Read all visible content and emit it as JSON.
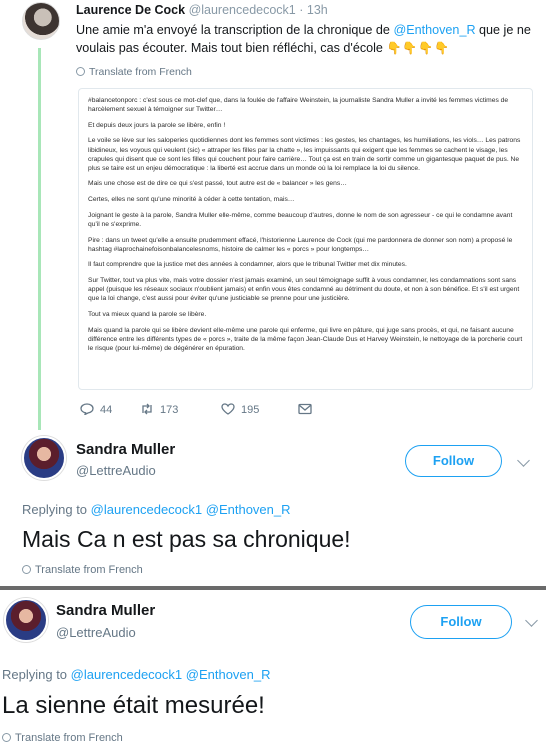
{
  "tweet1": {
    "name": "Laurence De Cock",
    "handle": "@laurencedecock1",
    "time": "· 13h",
    "text_a": "Une amie m'a envoyé la transcription de la chronique de ",
    "mention": "@Enthoven_R",
    "text_b": " que je ne voulais pas écouter. Mais tout bien réfléchi, cas d'école ",
    "emoji": "👇👇👇👇",
    "translate": "Translate from French",
    "quoted_paragraphs": [
      "#balancetonporc : c'est sous ce mot-clef que, dans la foulée de l'affaire Weinstein, la journaliste Sandra Muller a invité les femmes victimes de harcèlement sexuel à témoigner sur Twitter…",
      "Et depuis deux jours la parole se libère, enfin !",
      "Le voile se lève sur les saloperies quotidiennes dont les femmes sont victimes : les gestes, les chantages, les humiliations, les viols… Les patrons libidineux, les voyous qui veulent (sic) « attraper les filles par la chatte », les impuissants qui exigent que les femmes se cachent le visage, les crapules qui disent que ce sont les filles qui couchent pour faire carrière… Tout ça est en train de sortir comme un gigantesque paquet de pus. Ne plus se taire est un enjeu démocratique : la liberté est accrue dans un monde où la loi remplace la loi du silence.",
      "Mais une chose est de dire ce qui s'est passé, tout autre est de « balancer » les gens…",
      "Certes, elles ne sont qu'une minorité à céder à cette tentation, mais…",
      "Joignant le geste à la parole, Sandra Muller elle-même, comme beaucoup d'autres, donne le nom de son agresseur - ce qui le condamne avant qu'il ne s'exprime.",
      "Pire : dans un tweet qu'elle a ensuite prudemment effacé, l'historienne Laurence de Cock (qui me pardonnera de donner son nom) a proposé le hashtag #laprochainefoisonbalancelesnoms, histoire de calmer les « porcs » pour longtemps…",
      "Il faut comprendre que la justice met des années à condamner, alors que le tribunal Twitter met dix minutes.",
      "Sur Twitter, tout va plus vite, mais votre dossier n'est jamais examiné, un seul témoignage suffit à vous condamner, les condamnations sont sans appel (puisque les réseaux sociaux n'oublient jamais) et enfin vous êtes condamné au détriment du doute, et non à son bénéfice. Et s'il est urgent que la loi change, c'est aussi pour éviter qu'une justiciable se prenne pour une justicière.",
      "Tout va mieux quand la parole se libère.",
      "Mais quand la parole qui se libère devient elle-même une parole qui enferme, qui livre en pâture, qui juge sans procès, et qui, ne faisant aucune différence entre les différents types de « porcs », traite de la même façon Jean-Claude Dus et Harvey Weinstein, le nettoyage de la porcherie court le risque (pour lui-même) de dégénérer en épuration."
    ],
    "replies": "44",
    "retweets": "173",
    "likes": "195"
  },
  "tweet2": {
    "name": "Sandra Muller",
    "handle": "@LettreAudio",
    "follow": "Follow",
    "replying_label": "Replying to ",
    "replying_to": "@laurencedecock1 @Enthoven_R",
    "text": "Mais Ca n est pas sa chronique!",
    "translate": "Translate from French"
  },
  "tweet3": {
    "name": "Sandra Muller",
    "handle": "@LettreAudio",
    "follow": "Follow",
    "replying_label": "Replying to ",
    "replying_to": "@laurencedecock1 @Enthoven_R",
    "text": "La sienne était mesurée!",
    "translate": "Translate from French"
  },
  "colors": {
    "link": "#1da1f2",
    "muted": "#657786",
    "thread": "#a8e6b8"
  }
}
